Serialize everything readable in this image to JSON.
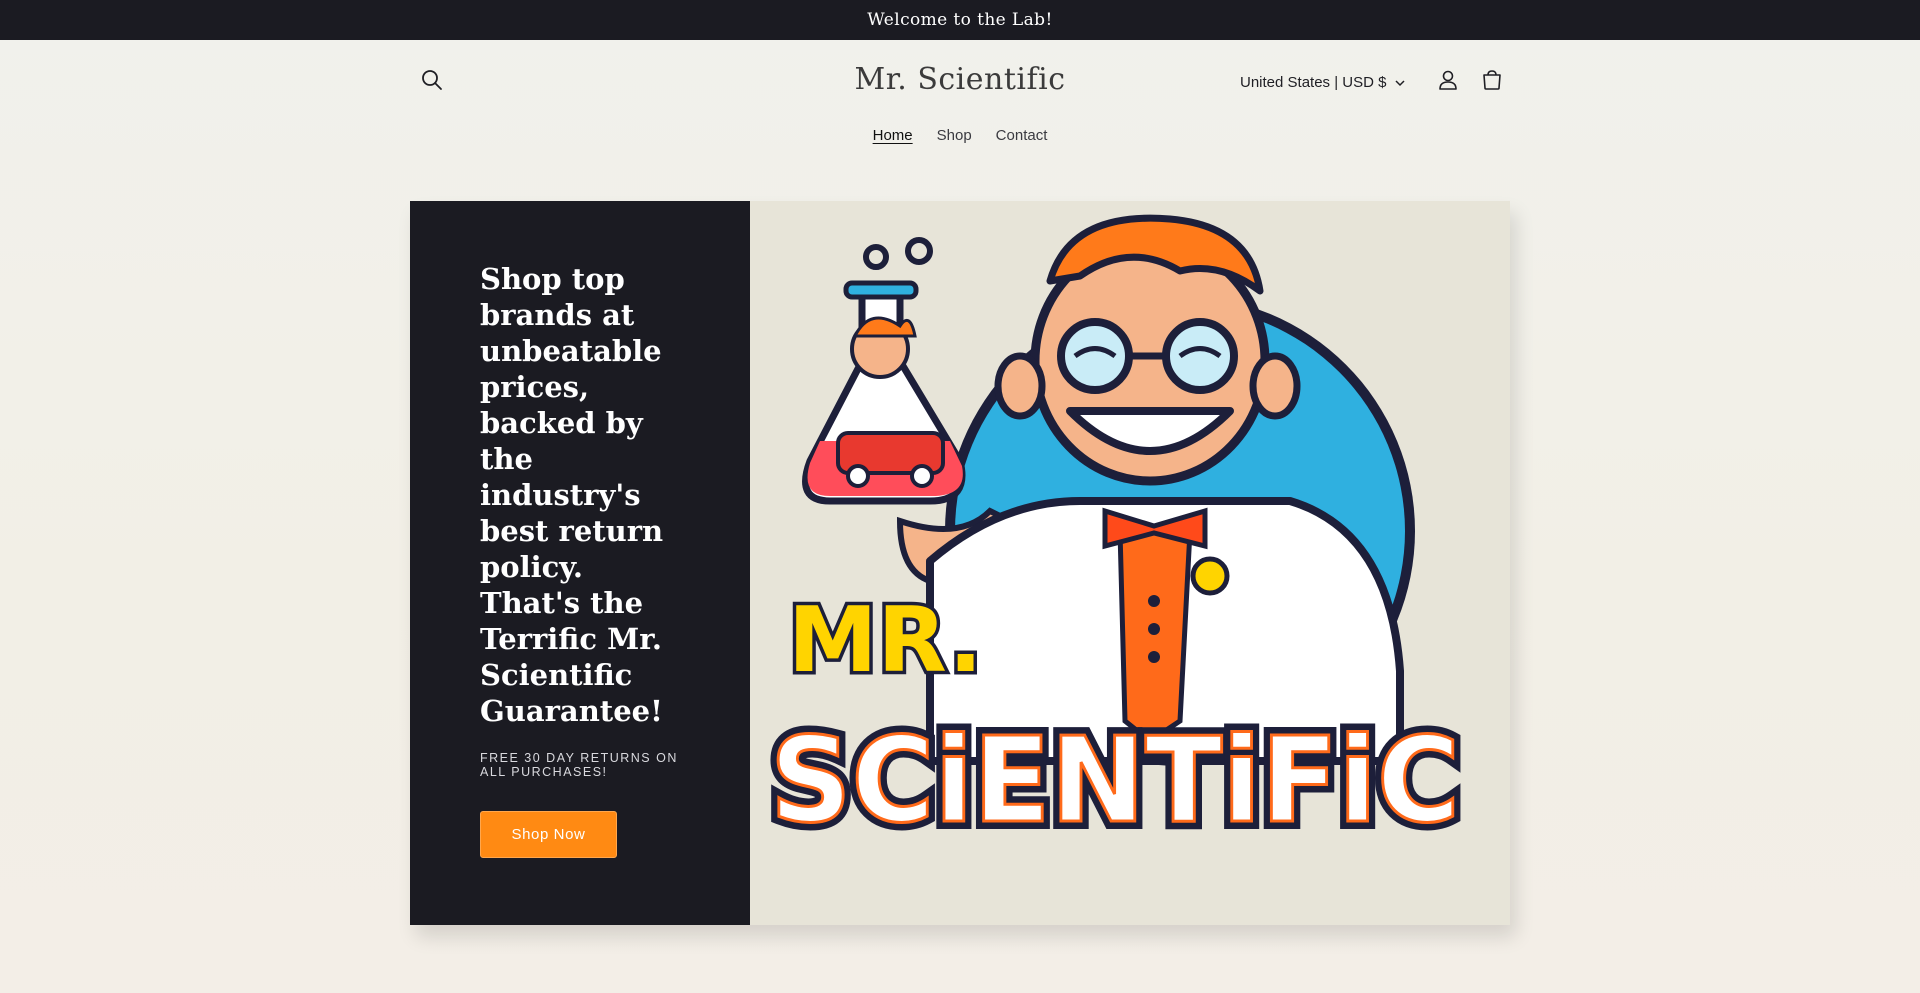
{
  "announcement": "Welcome to the Lab!",
  "header": {
    "logo": "Mr. Scientific",
    "locale": "United States | USD $",
    "icons": {
      "search": "search-icon",
      "account": "account-icon",
      "cart": "cart-icon",
      "dropdown": "chevron-down-icon"
    }
  },
  "nav": {
    "items": [
      "Home",
      "Shop",
      "Contact"
    ],
    "active": "Home"
  },
  "hero": {
    "heading": "Shop top brands at unbeatable prices, backed by the industry's best return policy. That's the Terrific Mr. Scientific Guarantee!",
    "subheading": "FREE 30 DAY RETURNS ON ALL PURCHASES!",
    "button": "Shop Now",
    "image_text": {
      "line1": "MR.",
      "line2": "SCiENTiFiC"
    }
  },
  "colors": {
    "dark": "#1b1b22",
    "accent": "#ff8a13",
    "logo_blue": "#2fb0e0",
    "logo_orange": "#ff6a1a",
    "logo_yellow": "#ffd400"
  }
}
